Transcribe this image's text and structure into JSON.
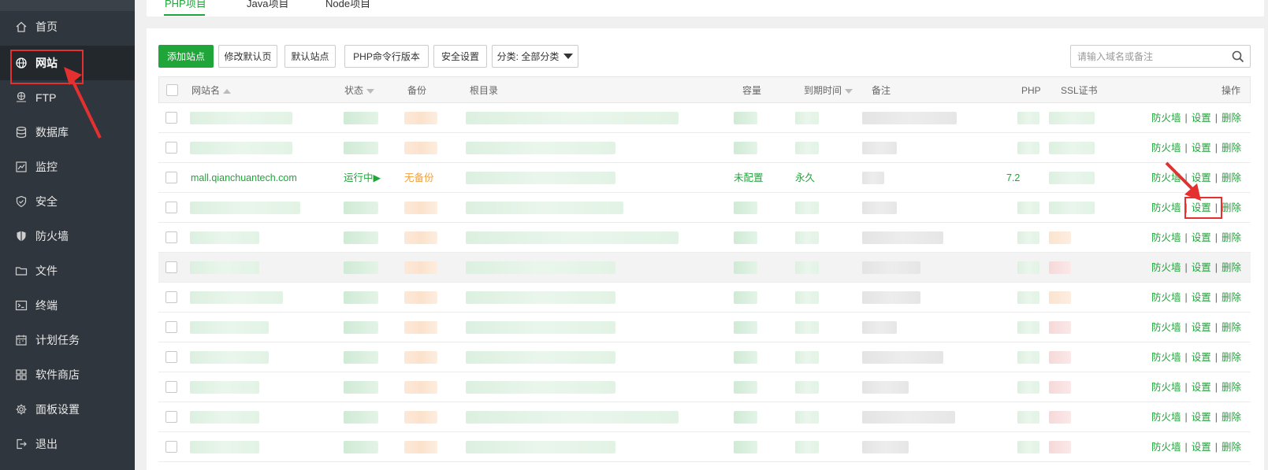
{
  "sidebar": {
    "items": [
      {
        "label": "首页",
        "icon": "home-icon"
      },
      {
        "label": "网站",
        "icon": "globe-icon",
        "active": true
      },
      {
        "label": "FTP",
        "icon": "ftp-icon"
      },
      {
        "label": "数据库",
        "icon": "database-icon"
      },
      {
        "label": "监控",
        "icon": "monitor-icon"
      },
      {
        "label": "安全",
        "icon": "shield-icon"
      },
      {
        "label": "防火墙",
        "icon": "firewall-icon"
      },
      {
        "label": "文件",
        "icon": "folder-icon"
      },
      {
        "label": "终端",
        "icon": "terminal-icon"
      },
      {
        "label": "计划任务",
        "icon": "calendar-icon"
      },
      {
        "label": "软件商店",
        "icon": "apps-icon"
      },
      {
        "label": "面板设置",
        "icon": "gear-icon"
      },
      {
        "label": "退出",
        "icon": "logout-icon"
      }
    ]
  },
  "tabs": [
    {
      "label": "PHP项目",
      "active": true
    },
    {
      "label": "Java项目"
    },
    {
      "label": "Node项目"
    }
  ],
  "toolbar": {
    "add_site": "添加站点",
    "edit_default_page": "修改默认页",
    "default_site": "默认站点",
    "php_cli_version": "PHP命令行版本",
    "security_settings": "安全设置",
    "category_select": "分类: 全部分类"
  },
  "search": {
    "placeholder": "请输入域名或备注"
  },
  "table": {
    "headers": {
      "site_name": "网站名",
      "status": "状态",
      "backup": "备份",
      "root_dir": "根目录",
      "capacity": "容量",
      "expire": "到期时间",
      "remark": "备注",
      "php": "PHP",
      "ssl": "SSL证书",
      "actions": "操作"
    },
    "action_labels": {
      "firewall": "防火墙",
      "settings": "设置",
      "delete": "删除",
      "separator": "|"
    },
    "visible_row": {
      "site_name": "mall.qianchuantech.com",
      "status": "运行中▶",
      "backup": "无备份",
      "capacity": "未配置",
      "expire": "永久",
      "php": "7.2"
    },
    "row_count": 12
  },
  "colors": {
    "accent_green": "#20a53a",
    "backup_orange": "#f0a040",
    "sidebar_bg": "#30363d",
    "annotation_red": "#e53030"
  }
}
